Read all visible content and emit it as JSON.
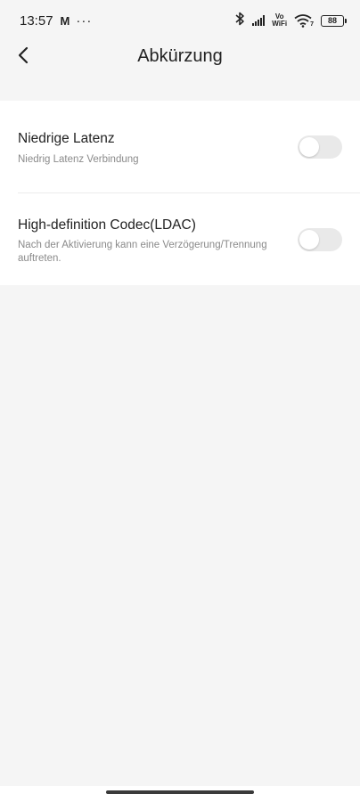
{
  "status_bar": {
    "time": "13:57",
    "gmail_icon": "M",
    "more_dots": "···",
    "vo": "Vo",
    "wifi_label": "WiFi",
    "wifi_sub": "7",
    "battery": "88"
  },
  "header": {
    "title": "Abkürzung",
    "back_icon": "chevron-left-icon"
  },
  "settings": [
    {
      "title": "Niedrige Latenz",
      "subtitle": "Niedrig Latenz Verbindung",
      "enabled": false
    },
    {
      "title": "High-definition Codec(LDAC)",
      "subtitle": "Nach der Aktivierung kann eine Verzögerung/Trennung auftreten.",
      "enabled": false
    }
  ],
  "colors": {
    "background": "#f5f5f5",
    "card": "#ffffff",
    "toggle_off": "#e9e9e9",
    "subtitle": "#8a8a8a"
  }
}
